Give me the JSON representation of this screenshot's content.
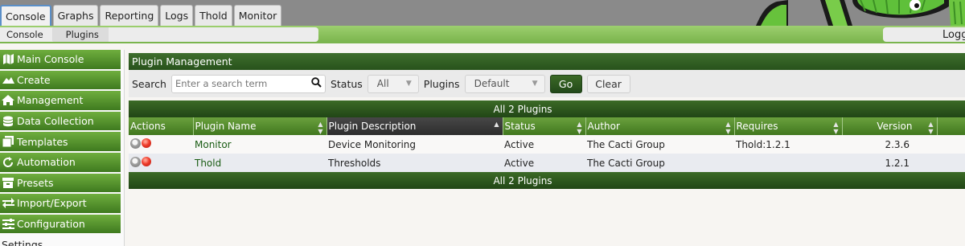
{
  "header": {
    "tabs": [
      {
        "label": "Console",
        "active": true
      },
      {
        "label": "Graphs"
      },
      {
        "label": "Reporting"
      },
      {
        "label": "Logs"
      },
      {
        "label": "Thold"
      },
      {
        "label": "Monitor"
      }
    ],
    "logo_icon": "cactus-logo-icon"
  },
  "breadcrumb": {
    "items": [
      "Console",
      "Plugins"
    ],
    "user_label": "Logg"
  },
  "sidebar": {
    "items": [
      {
        "label": "Main Console",
        "icon": "map-icon"
      },
      {
        "label": "Create",
        "icon": "mountain-icon"
      },
      {
        "label": "Management",
        "icon": "home-icon"
      },
      {
        "label": "Data Collection",
        "icon": "database-icon"
      },
      {
        "label": "Templates",
        "icon": "stack-icon"
      },
      {
        "label": "Automation",
        "icon": "refresh-icon"
      },
      {
        "label": "Presets",
        "icon": "presets-icon"
      },
      {
        "label": "Import/Export",
        "icon": "exchange-icon"
      },
      {
        "label": "Configuration",
        "icon": "sliders-icon"
      },
      {
        "label": "Settings",
        "icon": ""
      }
    ]
  },
  "panel": {
    "title": "Plugin Management",
    "filter": {
      "search_label": "Search",
      "search_placeholder": "Enter a search term",
      "status_label": "Status",
      "status_value": "All",
      "plugins_label": "Plugins",
      "plugins_value": "Default",
      "go_label": "Go",
      "clear_label": "Clear"
    },
    "summary_top": "All 2 Plugins",
    "summary_bottom": "All 2 Plugins",
    "columns": [
      "Actions",
      "Plugin Name",
      "Plugin Description",
      "Status",
      "Author",
      "Requires",
      "Version"
    ],
    "sorted_column": "Plugin Description",
    "rows": [
      {
        "name": "Monitor",
        "description": "Device Monitoring",
        "status": "Active",
        "author": "The Cacti Group",
        "requires": "Thold:1.2.1",
        "version": "2.3.6"
      },
      {
        "name": "Thold",
        "description": "Thresholds",
        "status": "Active",
        "author": "The Cacti Group",
        "requires": "",
        "version": "1.2.1"
      }
    ]
  },
  "colors": {
    "accent_green": "#3f7a1f",
    "header_dark_green": "#27521b",
    "link_green": "#1a5c14",
    "active_tab_border": "#5a8fc8"
  }
}
